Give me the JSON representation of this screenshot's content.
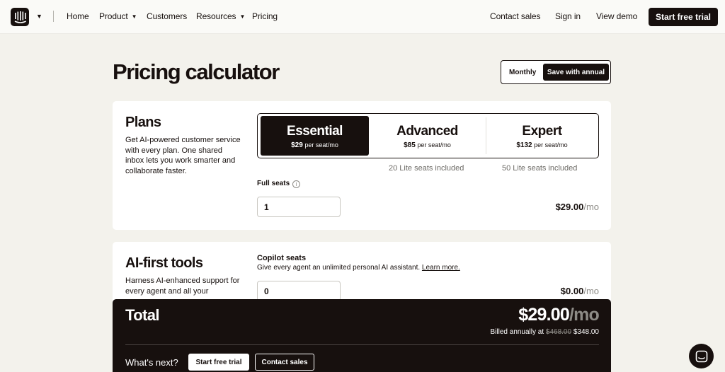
{
  "nav": {
    "links": [
      {
        "label": "Home"
      },
      {
        "label": "Product"
      },
      {
        "label": "Customers"
      },
      {
        "label": "Resources"
      },
      {
        "label": "Pricing"
      }
    ],
    "right": {
      "contact_sales": "Contact sales",
      "sign_in": "Sign in",
      "view_demo": "View demo",
      "start_trial": "Start free trial"
    }
  },
  "page": {
    "title": "Pricing calculator",
    "billing_toggle": {
      "monthly": "Monthly",
      "annual": "Save with annual",
      "selected": "annual"
    }
  },
  "plans_card": {
    "title": "Plans",
    "description": "Get AI-powered customer service with every plan. One shared inbox lets you work smarter and collaborate faster.",
    "plans": [
      {
        "name": "Essential",
        "price": "$29",
        "unit": "per seat/mo",
        "note": "",
        "selected": true
      },
      {
        "name": "Advanced",
        "price": "$85",
        "unit": "per seat/mo",
        "note": "20 Lite seats included",
        "selected": false
      },
      {
        "name": "Expert",
        "price": "$132",
        "unit": "per seat/mo",
        "note": "50 Lite seats included",
        "selected": false
      }
    ],
    "full_seats_label": "Full seats",
    "full_seats_value": "1",
    "line_price": "$29.00",
    "line_per": "/mo"
  },
  "ai_card": {
    "title": "AI-first tools",
    "description": "Harness AI-enhanced support for every agent and all your",
    "copilot_label": "Copilot seats",
    "copilot_desc": "Give every agent an unlimited personal AI assistant.",
    "learn_more": "Learn more.",
    "copilot_value": "0",
    "line_price": "$0.00",
    "line_per": "/mo"
  },
  "total": {
    "label": "Total",
    "amount": "$29.00",
    "per": "/mo",
    "billed_prefix": "Billed annually at",
    "billed_original": "$468.00",
    "billed_discounted": "$348.00",
    "whats_next": "What's next?",
    "start_trial": "Start free trial",
    "contact_sales": "Contact sales"
  },
  "icons": {
    "logo": "intercom-logo-icon",
    "info": "info-icon",
    "chat": "chat-launcher-icon"
  },
  "colors": {
    "brand_dark": "#17100e",
    "background": "#f3f2ec",
    "muted": "#8d8b86"
  }
}
